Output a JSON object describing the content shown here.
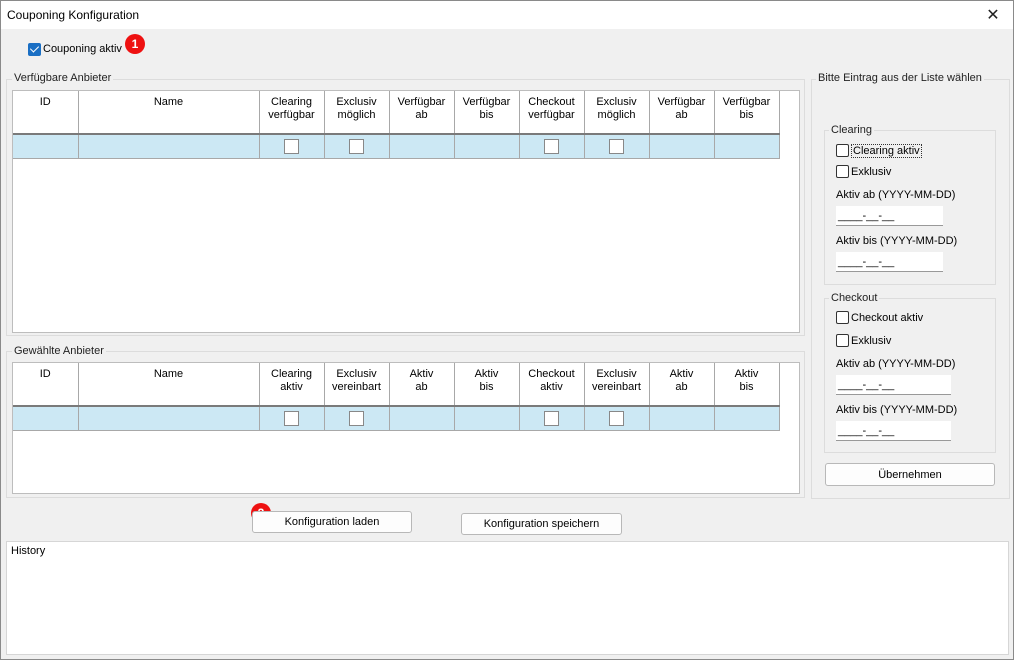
{
  "window": {
    "title": "Couponing Konfiguration",
    "close_glyph": "✕"
  },
  "couponing": {
    "label": "Couponing aktiv",
    "checked": true
  },
  "badges": {
    "one": "1",
    "two": "2"
  },
  "available": {
    "group_label": "Verfügbare Anbieter",
    "columns": [
      "ID",
      "Name",
      "Clearing\nverfügbar",
      "Exclusiv\nmöglich",
      "Verfügbar\nab",
      "Verfügbar\nbis",
      "Checkout\nverfügbar",
      "Exclusiv\nmöglich",
      "Verfügbar\nab",
      "Verfügbar\nbis"
    ]
  },
  "selected": {
    "group_label": "Gewählte Anbieter",
    "columns": [
      "ID",
      "Name",
      "Clearing\naktiv",
      "Exclusiv\nvereinbart",
      "Aktiv\nab",
      "Aktiv\nbis",
      "Checkout\naktiv",
      "Exclusiv\nvereinbart",
      "Aktiv\nab",
      "Aktiv\nbis"
    ]
  },
  "right_panel": {
    "group_label": "Bitte Eintrag aus der Liste wählen",
    "clearing": {
      "label": "Clearing",
      "active_label": "Clearing aktiv",
      "exclusive_label": "Exklusiv",
      "from_label": "Aktiv ab (YYYY-MM-DD)",
      "from_value": "____-__-__",
      "to_label": "Aktiv bis (YYYY-MM-DD)",
      "to_value": "____-__-__"
    },
    "checkout": {
      "label": "Checkout",
      "active_label": "Checkout aktiv",
      "exclusive_label": "Exklusiv",
      "from_label": "Aktiv ab (YYYY-MM-DD)",
      "from_value": "____-__-__",
      "to_label": "Aktiv bis (YYYY-MM-DD)",
      "to_value": "____-__-__"
    },
    "apply_label": "Übernehmen"
  },
  "buttons": {
    "load": "Konfiguration laden",
    "save": "Konfiguration speichern"
  },
  "history": {
    "label": "History"
  },
  "colors": {
    "selection_row": "#cce8f4",
    "accent": "#1a6fc4",
    "badge": "#e11111"
  }
}
